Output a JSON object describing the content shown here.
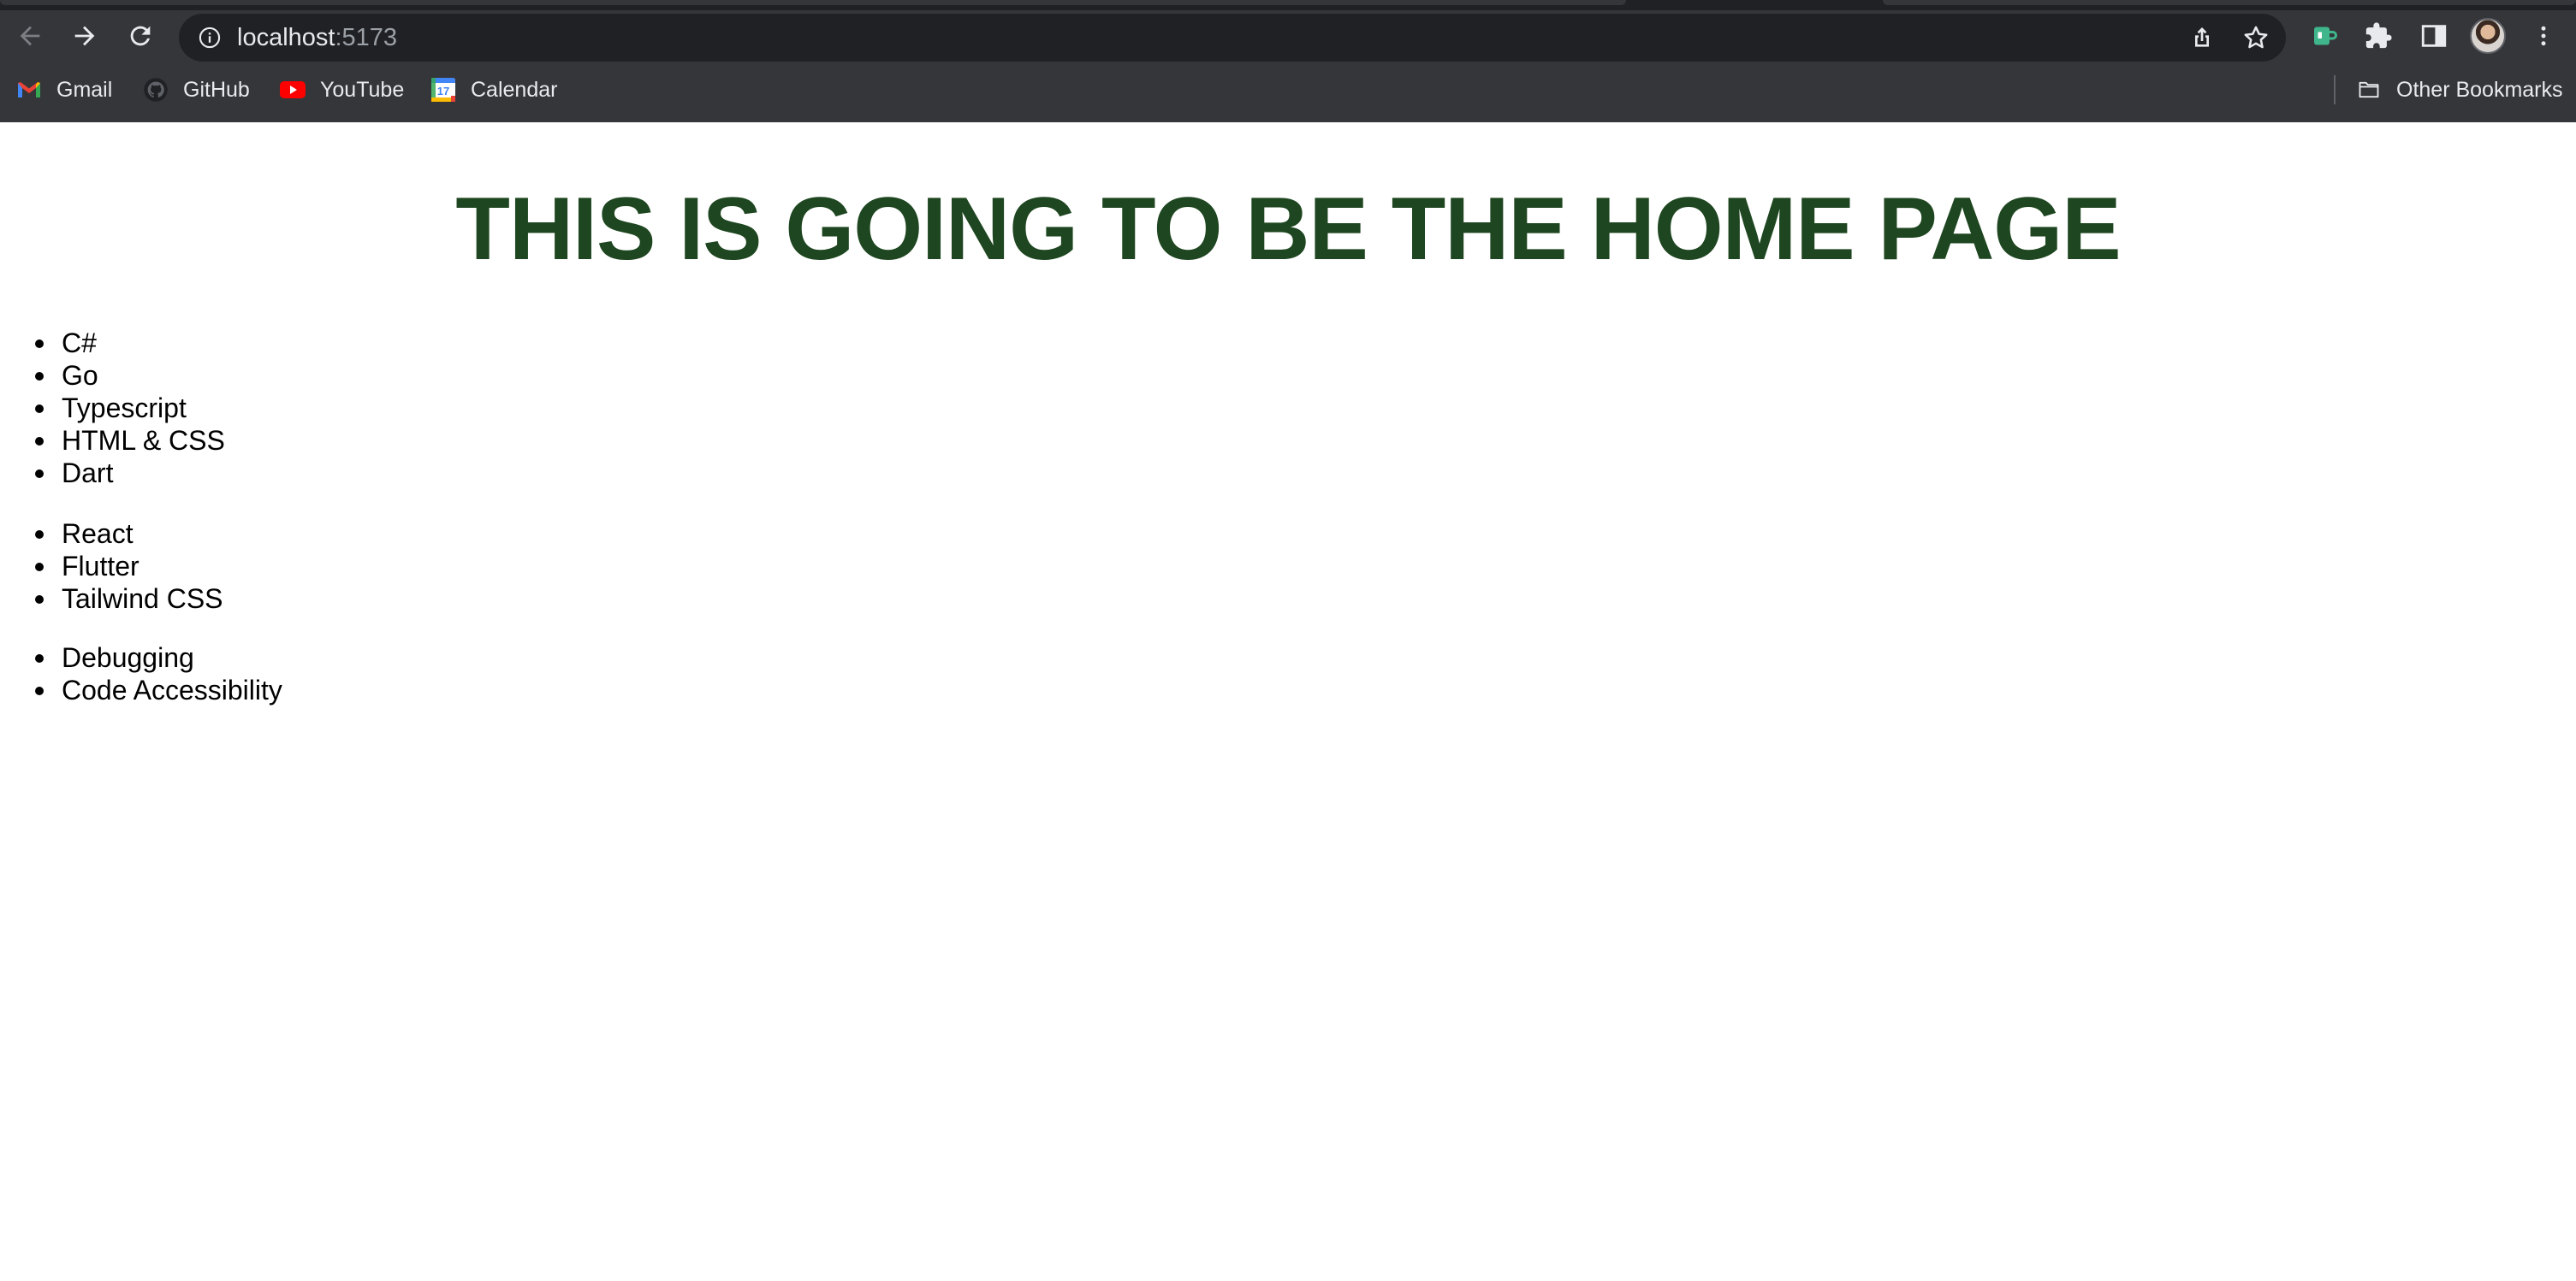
{
  "browser": {
    "url_host": "localhost",
    "url_port": ":5173",
    "colors": {
      "chrome_bg": "#35363a",
      "omnibox_bg": "#202124",
      "chrome_text": "#e8eaed"
    },
    "toolbar_icons": [
      "back-icon",
      "forward-icon",
      "reload-icon",
      "info-icon",
      "share-icon",
      "bookmark-star-icon",
      "extension-icon",
      "puzzle-icon",
      "side-panel-icon",
      "avatar",
      "menu-icon"
    ],
    "bookmarks": [
      {
        "label": "Gmail",
        "icon": "gmail-icon"
      },
      {
        "label": "GitHub",
        "icon": "github-icon"
      },
      {
        "label": "YouTube",
        "icon": "youtube-icon"
      },
      {
        "label": "Calendar",
        "icon": "calendar-icon"
      }
    ],
    "other_bookmarks_label": "Other Bookmarks",
    "calendar_icon_day": "17"
  },
  "page": {
    "title": "THIS IS GOING TO BE THE HOME PAGE",
    "title_color": "#1e4620",
    "lists": [
      {
        "items": [
          "C#",
          "Go",
          "Typescript",
          "HTML & CSS",
          "Dart"
        ]
      },
      {
        "items": [
          "React",
          "Flutter",
          "Tailwind CSS"
        ]
      },
      {
        "items": [
          "Debugging",
          "Code Accessibility"
        ]
      }
    ]
  }
}
